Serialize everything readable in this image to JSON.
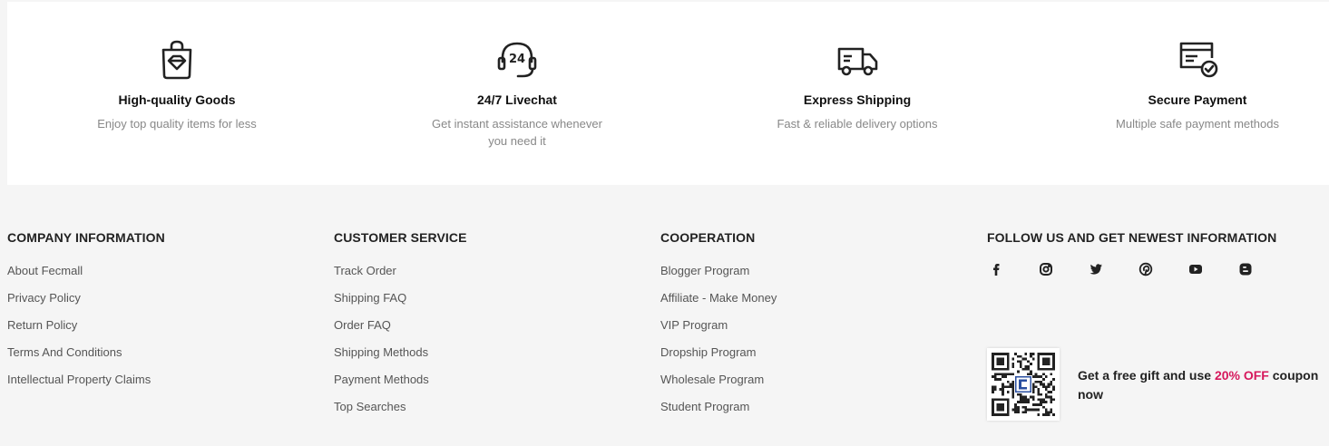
{
  "features": [
    {
      "icon": "shopping-bag-icon",
      "title": "High-quality Goods",
      "desc": "Enjoy top quality items for less"
    },
    {
      "icon": "headset-24-icon",
      "title": "24/7 Livechat",
      "desc": "Get instant assistance whenever you need it"
    },
    {
      "icon": "delivery-truck-icon",
      "title": "Express Shipping",
      "desc": "Fast & reliable delivery options"
    },
    {
      "icon": "secure-card-icon",
      "title": "Secure Payment",
      "desc": "Multiple safe payment methods"
    }
  ],
  "footer": {
    "company": {
      "heading": "COMPANY INFORMATION",
      "links": [
        "About Fecmall",
        "Privacy Policy",
        "Return Policy",
        "Terms And Conditions",
        "Intellectual Property Claims"
      ]
    },
    "service": {
      "heading": "CUSTOMER SERVICE",
      "links": [
        "Track Order",
        "Shipping FAQ",
        "Order FAQ",
        "Shipping Methods",
        "Payment Methods",
        "Top Searches"
      ]
    },
    "cooperation": {
      "heading": "COOPERATION",
      "links": [
        "Blogger Program",
        "Affiliate - Make Money",
        "VIP Program",
        "Dropship Program",
        "Wholesale Program",
        "Student Program"
      ]
    },
    "follow": {
      "heading": "FOLLOW US AND GET NEWEST INFORMATION",
      "social_icons": [
        "facebook-icon",
        "instagram-icon",
        "twitter-icon",
        "pinterest-icon",
        "youtube-icon",
        "blogger-icon"
      ],
      "promo_before": "Get a free gift and use ",
      "promo_highlight": "20% OFF",
      "promo_after": " coupon now",
      "highlight_color": "#d6185c"
    }
  }
}
